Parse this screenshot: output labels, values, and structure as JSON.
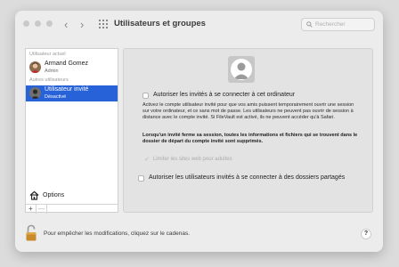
{
  "window": {
    "title": "Utilisateurs et groupes",
    "search_placeholder": "Rechercher"
  },
  "sidebar": {
    "current_user_header": "Utilisateur actuel",
    "other_users_header": "Autres utilisateurs",
    "users": [
      {
        "name": "Armand Gomez",
        "role": "Admin"
      },
      {
        "name": "Utilisateur invité",
        "role": "Désactivé"
      }
    ],
    "options_label": "Options",
    "add_symbol": "+",
    "remove_symbol": "—"
  },
  "main": {
    "allow_guests_label": "Autoriser les invités à se connecter à cet ordinateur",
    "description": "Activez le compte utilisateur invité pour que vos amis puissent temporairement ouvrir une session sur votre ordinateur, et ce sans mot de passe. Les utilisateurs ne peuvent pas ouvrir de session à distance avec le compte invité. Si FileVault est activé, ils ne peuvent accéder qu'à Safari.",
    "bold_note": "Lorsqu'un invité ferme sa session, toutes les informations et fichiers qui se trouvent dans le dossier de départ du compte invité sont supprimés.",
    "limit_sites_label": "Limiter les sites web pour adultes",
    "allow_shared_label": "Autoriser les utilisateurs invités à se connecter à des dossiers partagés"
  },
  "footer": {
    "lock_text": "Pour empêcher les modifications, cliquez sur le cadenas.",
    "help_symbol": "?"
  },
  "colors": {
    "selection": "#2762d8",
    "window_bg": "#ececec",
    "panel_bg": "#e3e3e3"
  },
  "icons": [
    "traffic-lights",
    "back-chevron-icon",
    "forward-chevron-icon",
    "grid-icon",
    "search-icon",
    "user-avatar-icon",
    "house-icon",
    "lock-icon",
    "help-icon"
  ]
}
